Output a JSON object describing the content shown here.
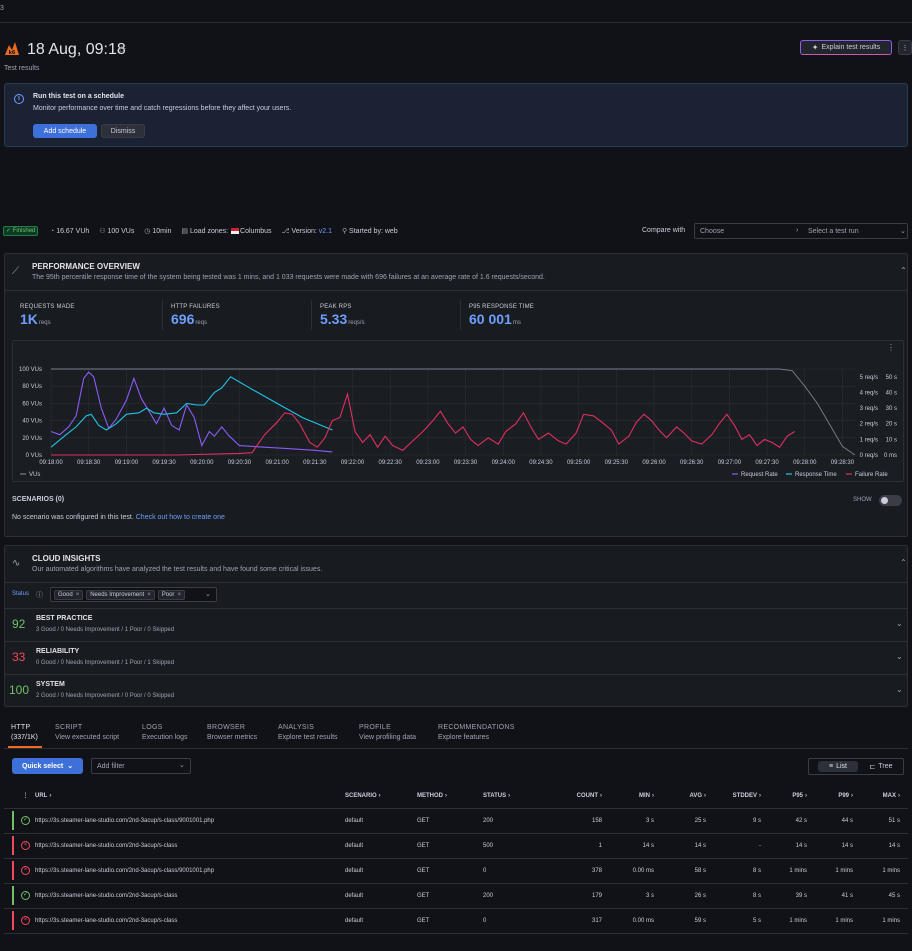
{
  "header": {
    "tiny_label": "3",
    "title": "18 Aug, 09:18",
    "subtitle": "Test results",
    "explain_button": "Explain test results",
    "more": "⋮"
  },
  "schedule_banner": {
    "title": "Run this test on a schedule",
    "text": "Monitor performance over time and catch regressions before they affect your users.",
    "add_button": "Add schedule",
    "dismiss_button": "Dismiss"
  },
  "meta": {
    "status": "Finished",
    "vuh": "16.67 VUh",
    "vus": "100 VUs",
    "duration": "10min",
    "load_zones_label": "Load zones:",
    "load_zone": "Columbus",
    "version_label": "Version:",
    "version": "v2.1",
    "started_by": "Started by: web",
    "compare_label": "Compare with",
    "compare_placeholder": "Choose",
    "test_run_placeholder": "Select a test run"
  },
  "performance": {
    "title": "PERFORMANCE OVERVIEW",
    "summary": "The 95th percentile response time of the system being tested was 1 mins, and 1 033 requests were made with 696 failures at an average rate of 1.6 requests/second.",
    "stats": [
      {
        "label": "REQUESTS MADE",
        "value": "1K",
        "unit": "reqs"
      },
      {
        "label": "HTTP FAILURES",
        "value": "696",
        "unit": "reqs"
      },
      {
        "label": "PEAK RPS",
        "value": "5.33",
        "unit": "reqs/s"
      },
      {
        "label": "P95 RESPONSE TIME",
        "value": "60 001",
        "unit": "ms"
      }
    ],
    "scenarios_label": "SCENARIOS (0)",
    "show_label": "SHOW",
    "no_scenario_text": "No scenario was configured in this test.",
    "no_scenario_link": "Check out how to create one"
  },
  "chart_data": {
    "type": "line",
    "x_ticks": [
      "09:18:00",
      "09:18:30",
      "09:19:00",
      "09:19:30",
      "09:20:00",
      "09:20:30",
      "09:21:00",
      "09:21:30",
      "09:22:00",
      "09:22:30",
      "09:23:00",
      "09:23:30",
      "09:24:00",
      "09:24:30",
      "09:25:00",
      "09:25:30",
      "09:26:00",
      "09:26:30",
      "09:27:00",
      "09:27:30",
      "09:28:00",
      "09:28:30"
    ],
    "y_left_ticks": [
      "0 VUs",
      "20 VUs",
      "40 VUs",
      "60 VUs",
      "80 VUs",
      "100 VUs"
    ],
    "y_mid_ticks": [
      "0 req/s",
      "1 req/s",
      "2 req/s",
      "3 req/s",
      "4 req/s",
      "5 req/s"
    ],
    "y_right_ticks": [
      "0 ms",
      "10 s",
      "20 s",
      "30 s",
      "40 s",
      "50 s"
    ],
    "ylim_vus": [
      0,
      100
    ],
    "ylim_rps": [
      0,
      5.5
    ],
    "ylim_ms": [
      0,
      55000
    ],
    "x_range_s": [
      0,
      640
    ],
    "series": [
      {
        "name": "VUs",
        "axis": "vus",
        "color": "#7b7e8c",
        "points": [
          [
            0,
            100
          ],
          [
            30,
            100
          ],
          [
            60,
            100
          ],
          [
            100,
            100
          ],
          [
            200,
            100
          ],
          [
            300,
            100
          ],
          [
            400,
            100
          ],
          [
            500,
            100
          ],
          [
            560,
            100
          ],
          [
            580,
            100
          ],
          [
            590,
            98
          ],
          [
            600,
            80
          ],
          [
            610,
            60
          ],
          [
            620,
            35
          ],
          [
            630,
            10
          ],
          [
            640,
            0
          ]
        ]
      },
      {
        "name": "Request Rate",
        "axis": "rps",
        "color": "#8a5cf6",
        "points": [
          [
            0,
            1.5
          ],
          [
            7,
            1.3
          ],
          [
            14,
            1.8
          ],
          [
            20,
            2.5
          ],
          [
            26,
            4.9
          ],
          [
            30,
            5.3
          ],
          [
            34,
            5.0
          ],
          [
            40,
            3.0
          ],
          [
            46,
            1.7
          ],
          [
            52,
            2.3
          ],
          [
            60,
            3.5
          ],
          [
            66,
            4.9
          ],
          [
            72,
            3.6
          ],
          [
            78,
            2.8
          ],
          [
            84,
            2.0
          ],
          [
            90,
            3.0
          ],
          [
            96,
            1.9
          ],
          [
            102,
            1.6
          ],
          [
            108,
            3.2
          ],
          [
            114,
            2.4
          ],
          [
            120,
            0.6
          ],
          [
            126,
            1.5
          ],
          [
            130,
            1.2
          ],
          [
            136,
            1.8
          ],
          [
            142,
            1.2
          ],
          [
            150,
            0.6
          ],
          [
            170,
            0.5
          ],
          [
            190,
            0.4
          ],
          [
            210,
            0.3
          ],
          [
            224,
            0.2
          ]
        ]
      },
      {
        "name": "Response Time",
        "axis": "ms",
        "color": "#20c5e6",
        "points": [
          [
            0,
            5000
          ],
          [
            12,
            13000
          ],
          [
            20,
            18000
          ],
          [
            28,
            25000
          ],
          [
            32,
            26000
          ],
          [
            38,
            19000
          ],
          [
            44,
            16000
          ],
          [
            52,
            20000
          ],
          [
            60,
            26000
          ],
          [
            70,
            27000
          ],
          [
            76,
            30000
          ],
          [
            82,
            27000
          ],
          [
            90,
            26000
          ],
          [
            100,
            27000
          ],
          [
            108,
            33000
          ],
          [
            116,
            32000
          ],
          [
            122,
            32000
          ],
          [
            130,
            40000
          ],
          [
            136,
            43000
          ],
          [
            143,
            50000
          ],
          [
            160,
            42000
          ],
          [
            180,
            33000
          ],
          [
            200,
            24000
          ],
          [
            224,
            16000
          ]
        ]
      },
      {
        "name": "Failure Rate",
        "axis": "rps",
        "color": "#e02f5d",
        "points": [
          [
            0,
            0
          ],
          [
            100,
            0
          ],
          [
            150,
            0.1
          ],
          [
            160,
            0.15
          ],
          [
            170,
            1.3
          ],
          [
            180,
            2.1
          ],
          [
            186,
            2.7
          ],
          [
            192,
            2.6
          ],
          [
            198,
            2.0
          ],
          [
            206,
            0.8
          ],
          [
            212,
            0.5
          ],
          [
            218,
            1.1
          ],
          [
            224,
            2.2
          ],
          [
            230,
            2.4
          ],
          [
            236,
            3.9
          ],
          [
            242,
            1.5
          ],
          [
            248,
            0.8
          ],
          [
            254,
            1.3
          ],
          [
            260,
            0.5
          ],
          [
            266,
            1.2
          ],
          [
            272,
            0.6
          ],
          [
            280,
            0.3
          ],
          [
            288,
            0.9
          ],
          [
            296,
            1.5
          ],
          [
            304,
            2.2
          ],
          [
            310,
            2.8
          ],
          [
            316,
            2.0
          ],
          [
            322,
            1.4
          ],
          [
            328,
            1.8
          ],
          [
            334,
            1.0
          ],
          [
            340,
            0.6
          ],
          [
            348,
            1.1
          ],
          [
            356,
            0.7
          ],
          [
            362,
            1.5
          ],
          [
            370,
            2.0
          ],
          [
            376,
            2.7
          ],
          [
            382,
            1.8
          ],
          [
            388,
            1.0
          ],
          [
            396,
            1.4
          ],
          [
            404,
            0.9
          ],
          [
            410,
            0.7
          ],
          [
            418,
            1.4
          ],
          [
            424,
            2.6
          ],
          [
            432,
            2.5
          ],
          [
            440,
            2.0
          ],
          [
            446,
            1.6
          ],
          [
            452,
            0.7
          ],
          [
            460,
            1.2
          ],
          [
            466,
            2.1
          ],
          [
            472,
            2.6
          ],
          [
            478,
            2.2
          ],
          [
            484,
            1.6
          ],
          [
            490,
            1.1
          ],
          [
            498,
            1.8
          ],
          [
            504,
            1.4
          ],
          [
            510,
            0.9
          ],
          [
            518,
            0.7
          ],
          [
            526,
            1.3
          ],
          [
            532,
            2.0
          ],
          [
            538,
            2.6
          ],
          [
            544,
            1.9
          ],
          [
            550,
            1.0
          ],
          [
            556,
            1.3
          ],
          [
            562,
            0.6
          ],
          [
            568,
            1.0
          ],
          [
            574,
            0.8
          ],
          [
            580,
            0.5
          ],
          [
            586,
            1.2
          ],
          [
            592,
            1.5
          ]
        ]
      }
    ],
    "legend": [
      "VUs",
      "Request Rate",
      "Response Time",
      "Failure Rate"
    ],
    "grid": true
  },
  "insights": {
    "title": "CLOUD INSIGHTS",
    "subtitle": "Our automated algorithms have analyzed the test results and have found some critical issues.",
    "status_label": "Status",
    "filters": [
      "Good",
      "Needs Improvement",
      "Poor"
    ],
    "rows": [
      {
        "score": "92",
        "color": "#73bf69",
        "name": "BEST PRACTICE",
        "detail": "3 Good / 0 Needs Improvement / 1 Poor / 0 Skipped"
      },
      {
        "score": "33",
        "color": "#f2495c",
        "name": "RELIABILITY",
        "detail": "0 Good / 0 Needs Improvement / 1 Poor / 1 Skipped"
      },
      {
        "score": "100",
        "color": "#73bf69",
        "name": "SYSTEM",
        "detail": "2 Good / 0 Needs Improvement / 0 Poor / 0 Skipped"
      }
    ]
  },
  "tabs": [
    {
      "title": "HTTP",
      "sub": "(337/1K)"
    },
    {
      "title": "SCRIPT",
      "sub": "View executed script"
    },
    {
      "title": "LOGS",
      "sub": "Execution logs"
    },
    {
      "title": "BROWSER",
      "sub": "Browser metrics"
    },
    {
      "title": "ANALYSIS",
      "sub": "Explore test results"
    },
    {
      "title": "PROFILE",
      "sub": "View profiling data"
    },
    {
      "title": "RECOMMENDATIONS",
      "sub": "Explore features"
    }
  ],
  "toolbar": {
    "quick_select": "Quick select",
    "filter_placeholder": "Add filter",
    "list": "List",
    "tree": "Tree"
  },
  "table": {
    "headers": [
      "URL",
      "SCENARIO",
      "METHOD",
      "STATUS",
      "COUNT",
      "MIN",
      "AVG",
      "STDDEV",
      "P95",
      "P99",
      "MAX"
    ],
    "rows": [
      {
        "ok": true,
        "cells": [
          "https://3s.steamer-lane-studio.com/2nd-3acup/s-class/9001001.php",
          "default",
          "GET",
          "200",
          "158",
          "3 s",
          "25 s",
          "9 s",
          "42 s",
          "44 s",
          "51 s"
        ]
      },
      {
        "ok": false,
        "cells": [
          "https://3s.steamer-lane-studio.com/2nd-3acup/s-class",
          "default",
          "GET",
          "500",
          "1",
          "14 s",
          "14 s",
          "-",
          "14 s",
          "14 s",
          "14 s"
        ]
      },
      {
        "ok": false,
        "cells": [
          "https://3s.steamer-lane-studio.com/2nd-3acup/s-class/9001001.php",
          "default",
          "GET",
          "0",
          "378",
          "0.00 ms",
          "58 s",
          "8 s",
          "1 mins",
          "1 mins",
          "1 mins"
        ]
      },
      {
        "ok": true,
        "cells": [
          "https://3s.steamer-lane-studio.com/2nd-3acup/s-class",
          "default",
          "GET",
          "200",
          "179",
          "3 s",
          "26 s",
          "8 s",
          "39 s",
          "41 s",
          "45 s"
        ]
      },
      {
        "ok": false,
        "cells": [
          "https://3s.steamer-lane-studio.com/2nd-3acup/s-class",
          "default",
          "GET",
          "0",
          "317",
          "0.00 ms",
          "59 s",
          "5 s",
          "1 mins",
          "1 mins",
          "1 mins"
        ]
      }
    ]
  },
  "colors": {
    "accent": "#3d71d9",
    "stat_blue": "#6e9fff",
    "good": "#73bf69",
    "bad": "#f2495c",
    "explain_border": "#8f5be8"
  }
}
